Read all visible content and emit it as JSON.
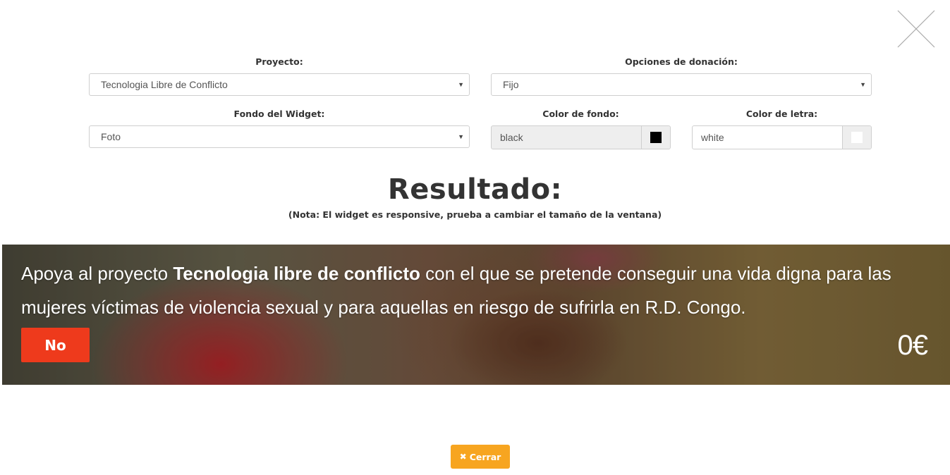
{
  "form": {
    "proyecto": {
      "label": "Proyecto:",
      "value": "Tecnologia Libre de Conflicto"
    },
    "opciones": {
      "label": "Opciones de donación:",
      "value": "Fijo"
    },
    "fondo": {
      "label": "Fondo del Widget:",
      "value": "Foto"
    },
    "color_fondo": {
      "label": "Color de fondo:",
      "value": "black",
      "swatch": "#000000"
    },
    "color_letra": {
      "label": "Color de letra:",
      "value": "white",
      "swatch": "#ffffff"
    }
  },
  "result": {
    "title": "Resultado:",
    "note": "(Nota: El widget es responsive, prueba a cambiar el tamaño de la ventana)"
  },
  "widget": {
    "text_before": "Apoya al proyecto ",
    "project_name": "Tecnologia libre de conflicto",
    "text_after": " con el que se pretende conseguir una vida digna para las mujeres víctimas de violencia sexual y para aquellas en riesgo de sufrirla en R.D. Congo.",
    "button_label": "No",
    "amount": "0€"
  },
  "footer": {
    "close_label": "Cerrar",
    "close_icon": "times-icon"
  },
  "colors": {
    "accent_red": "#ee3a1c",
    "accent_orange": "#f7a520"
  }
}
